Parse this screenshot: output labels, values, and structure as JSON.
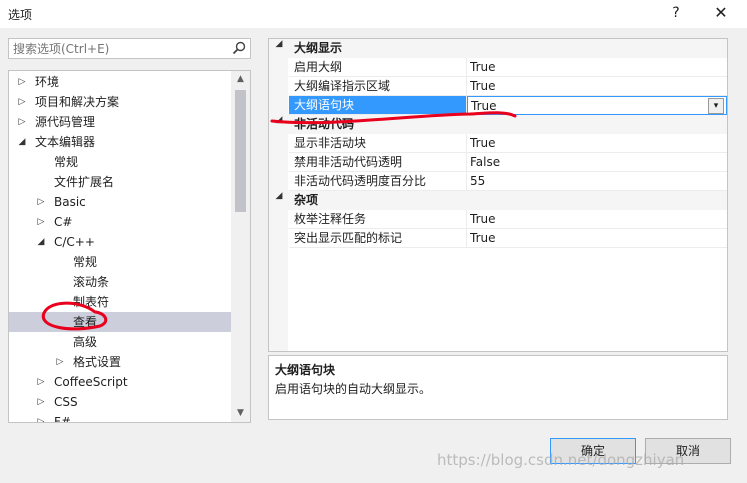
{
  "window": {
    "title": "选项",
    "help_label": "?",
    "close_label": "✕"
  },
  "search": {
    "placeholder": "搜索选项(Ctrl+E)",
    "icon": "search-icon"
  },
  "tree": {
    "items": [
      {
        "label": "环境",
        "level": 0,
        "arrow": "▷",
        "selected": false
      },
      {
        "label": "项目和解决方案",
        "level": 0,
        "arrow": "▷",
        "selected": false
      },
      {
        "label": "源代码管理",
        "level": 0,
        "arrow": "▷",
        "selected": false
      },
      {
        "label": "文本编辑器",
        "level": 0,
        "arrow": "◢",
        "selected": false
      },
      {
        "label": "常规",
        "level": 1,
        "arrow": "",
        "selected": false
      },
      {
        "label": "文件扩展名",
        "level": 1,
        "arrow": "",
        "selected": false
      },
      {
        "label": "Basic",
        "level": 1,
        "arrow": "▷",
        "selected": false
      },
      {
        "label": "C#",
        "level": 1,
        "arrow": "▷",
        "selected": false
      },
      {
        "label": "C/C++",
        "level": 1,
        "arrow": "◢",
        "selected": false
      },
      {
        "label": "常规",
        "level": 2,
        "arrow": "",
        "selected": false
      },
      {
        "label": "滚动条",
        "level": 2,
        "arrow": "",
        "selected": false
      },
      {
        "label": "制表符",
        "level": 2,
        "arrow": "",
        "selected": false
      },
      {
        "label": "查看",
        "level": 2,
        "arrow": "",
        "selected": true
      },
      {
        "label": "高级",
        "level": 2,
        "arrow": "",
        "selected": false
      },
      {
        "label": "格式设置",
        "level": 2,
        "arrow": "▷",
        "selected": false
      },
      {
        "label": "CoffeeScript",
        "level": 1,
        "arrow": "▷",
        "selected": false
      },
      {
        "label": "CSS",
        "level": 1,
        "arrow": "▷",
        "selected": false
      },
      {
        "label": "F#",
        "level": 1,
        "arrow": "▷",
        "selected": false
      }
    ]
  },
  "properties": {
    "categories": [
      {
        "name": "大纲显示",
        "rows": [
          {
            "name": "启用大纲",
            "value": "True",
            "selected": false
          },
          {
            "name": "大纲编译指示区域",
            "value": "True",
            "selected": false
          },
          {
            "name": "大纲语句块",
            "value": "True",
            "selected": true
          }
        ]
      },
      {
        "name": "非活动代码",
        "rows": [
          {
            "name": "显示非活动块",
            "value": "True",
            "selected": false
          },
          {
            "name": "禁用非活动代码透明",
            "value": "False",
            "selected": false
          },
          {
            "name": "非活动代码透明度百分比",
            "value": "55",
            "selected": false
          }
        ]
      },
      {
        "name": "杂项",
        "rows": [
          {
            "name": "枚举注释任务",
            "value": "True",
            "selected": false
          },
          {
            "name": "突出显示匹配的标记",
            "value": "True",
            "selected": false
          }
        ]
      }
    ]
  },
  "description": {
    "title": "大纲语句块",
    "text": "启用语句块的自动大纲显示。"
  },
  "buttons": {
    "ok": "确定",
    "cancel": "取消"
  },
  "watermark": "https://blog.csdn.net/dongzhiyan",
  "colors": {
    "selection": "#3399ff",
    "tree_selected": "#cccedb",
    "annotation": "#e8001c"
  }
}
